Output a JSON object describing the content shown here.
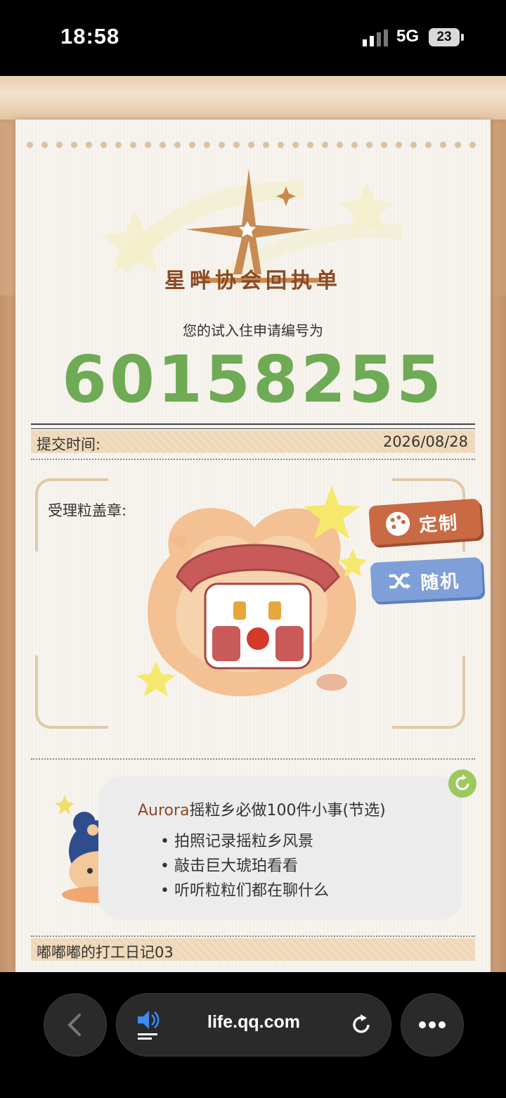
{
  "status": {
    "time": "18:58",
    "network": "5G",
    "battery": "23"
  },
  "receipt": {
    "logo_title": "星畔协会回执单",
    "subtitle": "您的试入住申请编号为",
    "application_number": "60158255",
    "submit_label": "提交时间:",
    "submit_date": "2026/08/28",
    "stamp_label": "受理粒盖章:"
  },
  "actions": {
    "custom": "定制",
    "random": "随机"
  },
  "tips": {
    "title_brand": "Aurora",
    "title_rest": "摇粒乡必做100件小事(节选)",
    "items": [
      "拍照记录摇粒乡风景",
      "敲击巨大琥珀看看",
      "听听粒粒们都在聊什么"
    ]
  },
  "diary": {
    "label": "嘟嘟嘟的打工日记03"
  },
  "browser": {
    "url": "life.qq.com"
  },
  "colors": {
    "number_green": "#6faa55",
    "brand_brown": "#8b4a24",
    "custom_btn": "#c96a44",
    "random_btn": "#7f9fd8"
  }
}
